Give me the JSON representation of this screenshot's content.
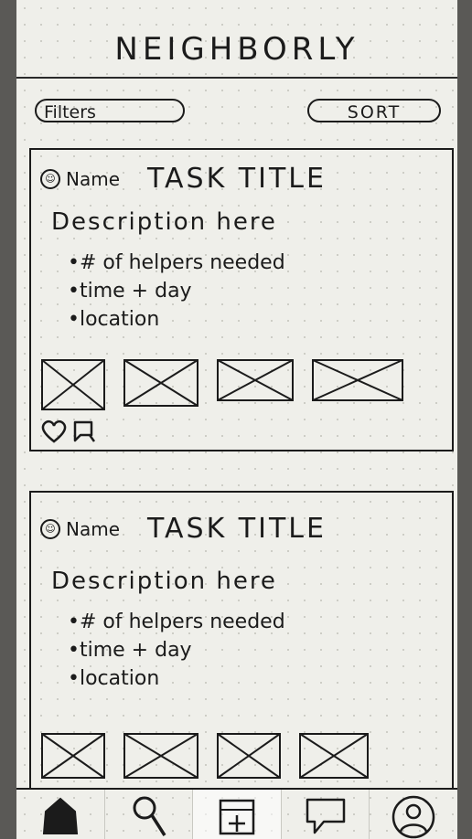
{
  "app": {
    "title": "NEIGHBORLY"
  },
  "toolbar": {
    "filters_label": "Filters",
    "sort_label": "SORT"
  },
  "cards": [
    {
      "author": "Name",
      "title": "TASK TITLE",
      "description": "Description here",
      "details": [
        "# of helpers needed",
        "time + day",
        "location"
      ],
      "image_count": 4,
      "actions": [
        "heart-icon",
        "chat-icon"
      ]
    },
    {
      "author": "Name",
      "title": "TASK TITLE",
      "description": "Description here",
      "details": [
        "# of helpers needed",
        "time + day",
        "location"
      ],
      "image_count": 4
    }
  ],
  "nav": {
    "items": [
      "home-icon",
      "search-icon",
      "add-task-icon",
      "messages-icon",
      "profile-icon"
    ],
    "active": "add-task-icon"
  },
  "colors": {
    "ink": "#1b1b1b",
    "paper": "#efefea",
    "backdrop": "#5a5956"
  }
}
